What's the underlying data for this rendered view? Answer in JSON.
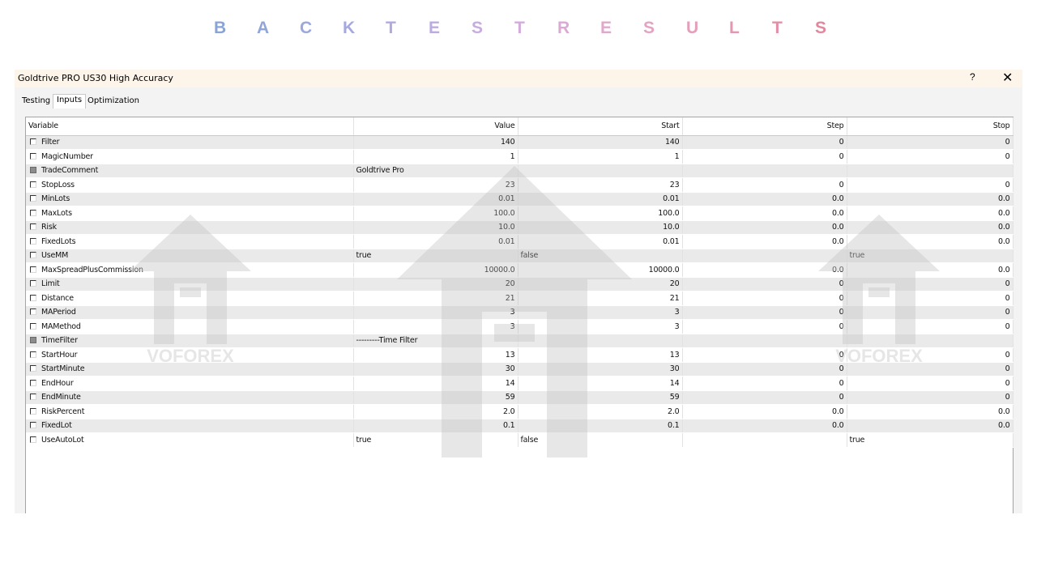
{
  "banner": {
    "letters": [
      {
        "ch": "B",
        "color": "#8aa4d6"
      },
      {
        "ch": "A",
        "color": "#90a6d8"
      },
      {
        "ch": "C",
        "color": "#9aa8dc"
      },
      {
        "ch": "K",
        "color": "#a6a9de"
      },
      {
        "ch": "T",
        "color": "#b2aadf"
      },
      {
        "ch": "E",
        "color": "#bcabe0"
      },
      {
        "ch": "S",
        "color": "#c7ace0"
      },
      {
        "ch": "T",
        "color": "#d3acdc"
      },
      {
        "ch": "R",
        "color": "#dbaad4"
      },
      {
        "ch": "E",
        "color": "#e0a8cc"
      },
      {
        "ch": "S",
        "color": "#e4a3c2"
      },
      {
        "ch": "U",
        "color": "#e59ebb"
      },
      {
        "ch": "L",
        "color": "#e597b2"
      },
      {
        "ch": "T",
        "color": "#e48fa8"
      },
      {
        "ch": "S",
        "color": "#e2879c"
      }
    ]
  },
  "window": {
    "title": "Goldtrive PRO US30 High Accuracy",
    "help_label": "?",
    "close_label": "✕"
  },
  "tabs": [
    {
      "label": "Testing",
      "active": false
    },
    {
      "label": "Inputs",
      "active": true
    },
    {
      "label": "Optimization",
      "active": false
    }
  ],
  "table": {
    "headers": [
      "Variable",
      "Value",
      "Start",
      "Step",
      "Stop"
    ],
    "rows": [
      {
        "variable": "Filter",
        "value": "140",
        "start": "140",
        "step": "0",
        "stop": "0",
        "enabled": true
      },
      {
        "variable": "MagicNumber",
        "value": "1",
        "start": "1",
        "step": "0",
        "stop": "0",
        "enabled": true
      },
      {
        "variable": "TradeComment",
        "value": "Goldtrive Pro",
        "start": "",
        "step": "",
        "stop": "",
        "enabled": false
      },
      {
        "variable": "StopLoss",
        "value": "23",
        "start": "23",
        "step": "0",
        "stop": "0",
        "enabled": true
      },
      {
        "variable": "MinLots",
        "value": "0.01",
        "start": "0.01",
        "step": "0.0",
        "stop": "0.0",
        "enabled": true
      },
      {
        "variable": "MaxLots",
        "value": "100.0",
        "start": "100.0",
        "step": "0.0",
        "stop": "0.0",
        "enabled": true
      },
      {
        "variable": "Risk",
        "value": "10.0",
        "start": "10.0",
        "step": "0.0",
        "stop": "0.0",
        "enabled": true
      },
      {
        "variable": "FixedLots",
        "value": "0.01",
        "start": "0.01",
        "step": "0.0",
        "stop": "0.0",
        "enabled": true
      },
      {
        "variable": "UseMM",
        "value": "true",
        "start": "false",
        "step": "",
        "stop": "true",
        "enabled": true
      },
      {
        "variable": "MaxSpreadPlusCommission",
        "value": "10000.0",
        "start": "10000.0",
        "step": "0.0",
        "stop": "0.0",
        "enabled": true
      },
      {
        "variable": "Limit",
        "value": "20",
        "start": "20",
        "step": "0",
        "stop": "0",
        "enabled": true
      },
      {
        "variable": "Distance",
        "value": "21",
        "start": "21",
        "step": "0",
        "stop": "0",
        "enabled": true
      },
      {
        "variable": "MAPeriod",
        "value": "3",
        "start": "3",
        "step": "0",
        "stop": "0",
        "enabled": true
      },
      {
        "variable": "MAMethod",
        "value": "3",
        "start": "3",
        "step": "0",
        "stop": "0",
        "enabled": true
      },
      {
        "variable": "TimeFilter",
        "value": "---------Time Filter",
        "start": "",
        "step": "",
        "stop": "",
        "enabled": false
      },
      {
        "variable": "StartHour",
        "value": "13",
        "start": "13",
        "step": "0",
        "stop": "0",
        "enabled": true
      },
      {
        "variable": "StartMinute",
        "value": "30",
        "start": "30",
        "step": "0",
        "stop": "0",
        "enabled": true
      },
      {
        "variable": "EndHour",
        "value": "14",
        "start": "14",
        "step": "0",
        "stop": "0",
        "enabled": true
      },
      {
        "variable": "EndMinute",
        "value": "59",
        "start": "59",
        "step": "0",
        "stop": "0",
        "enabled": true
      },
      {
        "variable": "RiskPercent",
        "value": "2.0",
        "start": "2.0",
        "step": "0.0",
        "stop": "0.0",
        "enabled": true
      },
      {
        "variable": "FixedLot",
        "value": "0.1",
        "start": "0.1",
        "step": "0.0",
        "stop": "0.0",
        "enabled": true
      },
      {
        "variable": "UseAutoLot",
        "value": "true",
        "start": "false",
        "step": "",
        "stop": "true",
        "enabled": true
      }
    ]
  },
  "watermark": {
    "logo_icon": "house-h-logo-icon",
    "color": "#d9d9d9"
  }
}
